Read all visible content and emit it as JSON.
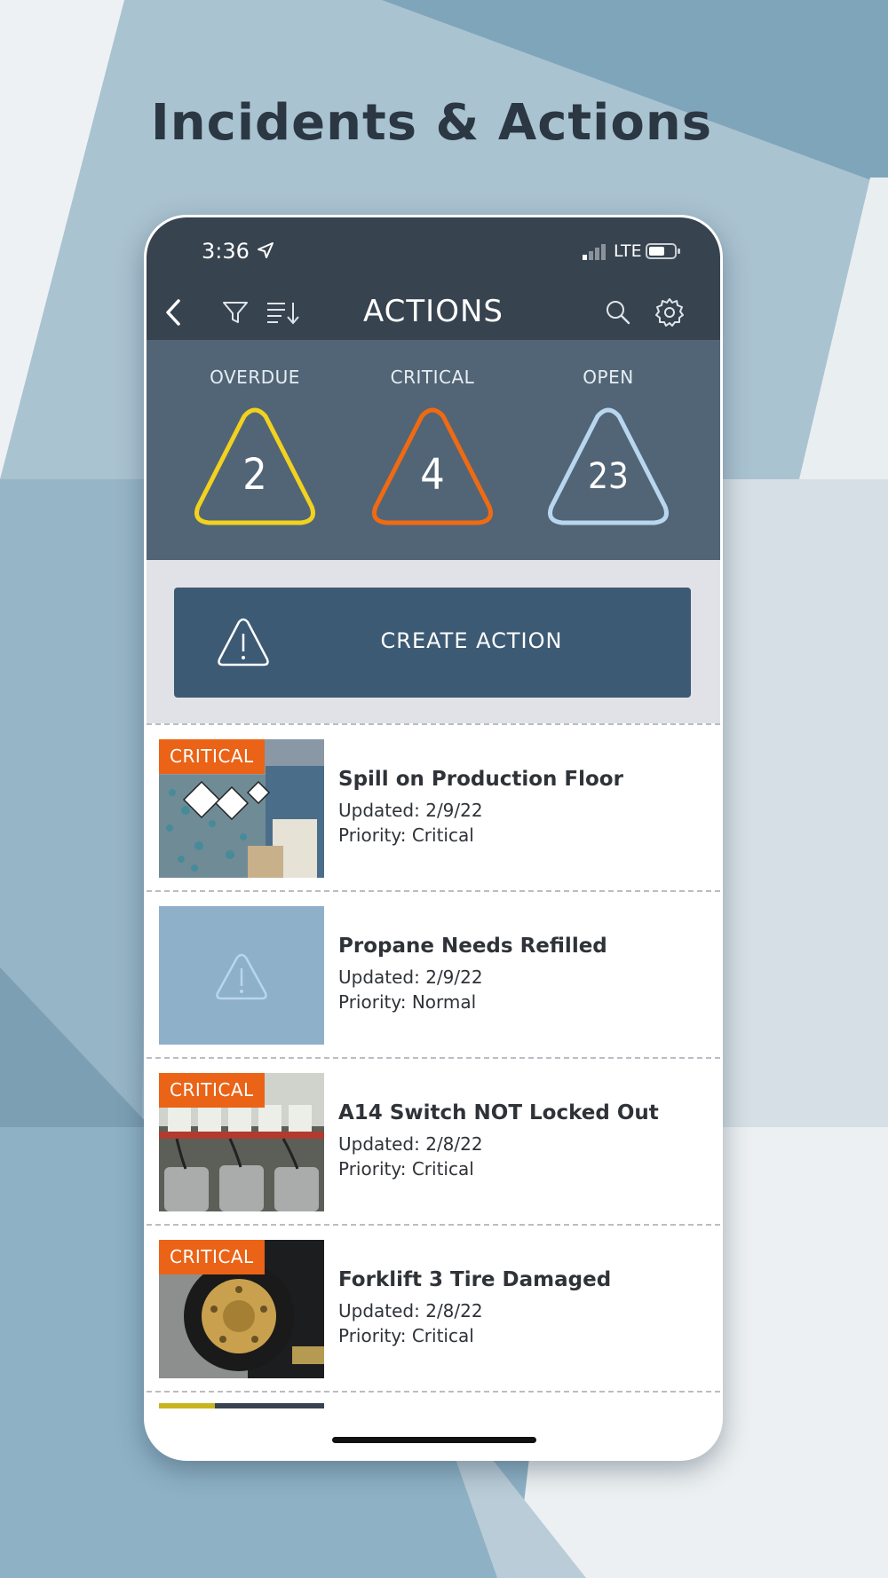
{
  "promo_title": "Incidents & Actions",
  "status_bar": {
    "time": "3:36",
    "network": "LTE"
  },
  "nav": {
    "title": "ACTIONS"
  },
  "stats": [
    {
      "label": "OVERDUE",
      "value": "2",
      "color": "#f2d21e"
    },
    {
      "label": "CRITICAL",
      "value": "4",
      "color": "#f06a12"
    },
    {
      "label": "OPEN",
      "value": "23",
      "color": "#b9d6ef"
    }
  ],
  "create_action": {
    "label": "CREATE ACTION"
  },
  "actions": [
    {
      "badge": "CRITICAL",
      "title": "Spill on Production Floor",
      "updated": "Updated: 2/9/22",
      "priority": "Priority: Critical"
    },
    {
      "badge": "",
      "title": "Propane Needs Refilled",
      "updated": "Updated: 2/9/22",
      "priority": "Priority: Normal"
    },
    {
      "badge": "CRITICAL",
      "title": "A14 Switch NOT Locked Out",
      "updated": "Updated: 2/8/22",
      "priority": "Priority: Critical"
    },
    {
      "badge": "CRITICAL",
      "title": "Forklift 3 Tire Damaged",
      "updated": "Updated: 2/8/22",
      "priority": "Priority: Critical"
    }
  ],
  "bottom_progress": 0.34,
  "colors": {
    "accent": "#ea6317",
    "nav_bg": "#37434f",
    "stats_bg": "#526576",
    "button_bg": "#3d5a75"
  }
}
